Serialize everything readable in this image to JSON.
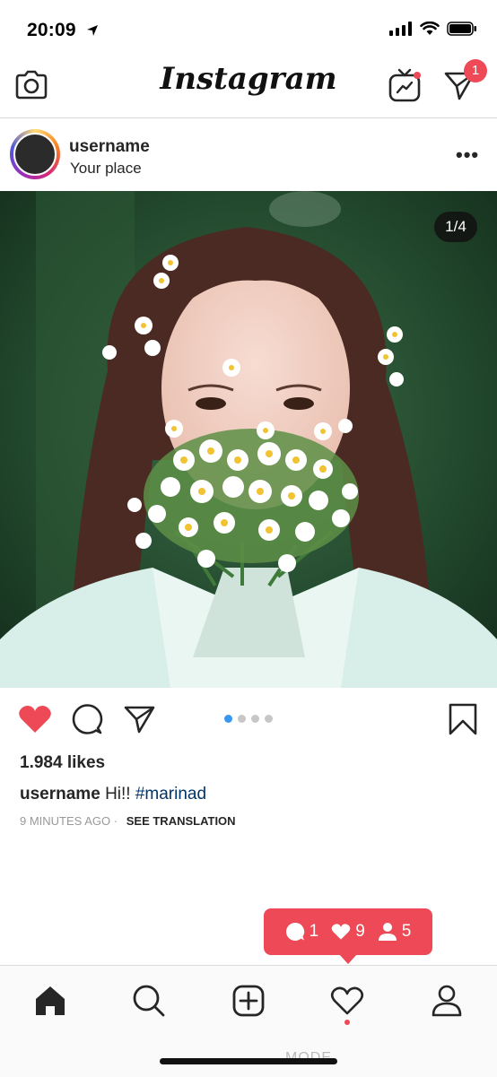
{
  "status_bar": {
    "time": "20:09",
    "icons": [
      "location-arrow-icon",
      "signal-bars-icon",
      "wifi-icon",
      "battery-icon"
    ]
  },
  "header": {
    "title": "Instagram",
    "notification_count": "1",
    "icons": [
      "camera-icon",
      "igtv-icon",
      "direct-message-icon"
    ]
  },
  "post": {
    "username": "username",
    "location": "Your place",
    "more_label": "•••",
    "image_counter": "1/4",
    "carousel": {
      "total": 4,
      "active": 1
    },
    "likes": "1.984 likes",
    "caption_user": "username",
    "caption_text": "Hi!!",
    "caption_hashtag": "#marinad",
    "time_ago": "9 MINUTES AGO",
    "separator": "·",
    "see_translation": "SEE TRANSLATION",
    "liked": true
  },
  "activity": {
    "comments": "1",
    "likes": "9",
    "follows": "5"
  },
  "tabbar": {
    "items": [
      "home-icon",
      "search-icon",
      "add-post-icon",
      "activity-heart-icon",
      "profile-icon"
    ],
    "active": "home"
  },
  "watermark": "MODE",
  "colors": {
    "accent_red": "#ed4956",
    "link_blue": "#003569",
    "active_dot": "#3897f0",
    "divider": "#dbdbdb"
  }
}
